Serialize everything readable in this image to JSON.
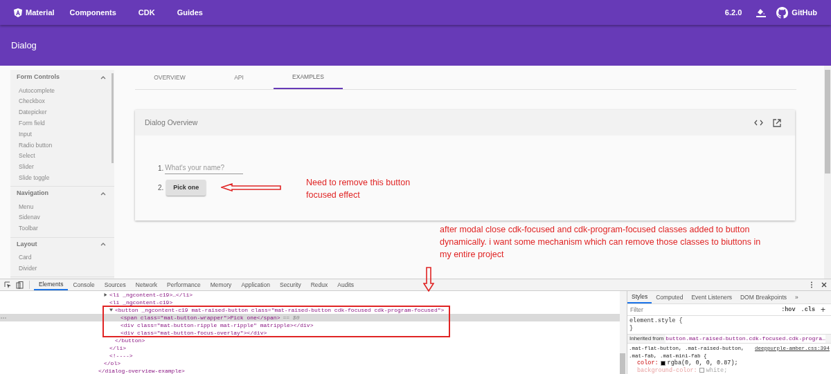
{
  "topnav": {
    "items": [
      {
        "label": "Material",
        "kind": "brand"
      },
      {
        "label": "Components",
        "kind": "link"
      },
      {
        "label": "CDK",
        "kind": "link"
      },
      {
        "label": "Guides",
        "kind": "link"
      }
    ],
    "version": "6.2.0",
    "github": "GitHub"
  },
  "header": {
    "title": "Dialog"
  },
  "sidebar": {
    "groups": [
      {
        "title": "Form Controls",
        "expanded": true,
        "items": [
          "Autocomplete",
          "Checkbox",
          "Datepicker",
          "Form field",
          "Input",
          "Radio button",
          "Select",
          "Slider",
          "Slide toggle"
        ]
      },
      {
        "title": "Navigation",
        "expanded": true,
        "items": [
          "Menu",
          "Sidenav",
          "Toolbar"
        ]
      },
      {
        "title": "Layout",
        "expanded": true,
        "items": [
          "Card",
          "Divider"
        ]
      }
    ]
  },
  "tabs": [
    {
      "label": "OVERVIEW",
      "selected": false
    },
    {
      "label": "API",
      "selected": false
    },
    {
      "label": "EXAMPLES",
      "selected": true
    }
  ],
  "example": {
    "title": "Dialog Overview",
    "steps": [
      {
        "number": "1.",
        "kind": "input",
        "placeholder": "What's your name?"
      },
      {
        "number": "2.",
        "kind": "button",
        "label": "Pick one"
      }
    ]
  },
  "annotations": [
    {
      "text": "Need to remove this button focused effect",
      "kind": "left-arrow"
    },
    {
      "text": "after modal close cdk-focused and cdk-program-focused classes added to button dynamically. i want some mechanism which can remove those classes to biuttons in my entire project",
      "kind": "down-arrow"
    }
  ],
  "devtools": {
    "tabs": [
      {
        "label": "Elements",
        "selected": true
      },
      {
        "label": "Console",
        "selected": false
      },
      {
        "label": "Sources",
        "selected": false
      },
      {
        "label": "Network",
        "selected": false
      },
      {
        "label": "Performance",
        "selected": false
      },
      {
        "label": "Memory",
        "selected": false
      },
      {
        "label": "Application",
        "selected": false
      },
      {
        "label": "Security",
        "selected": false
      },
      {
        "label": "Redux",
        "selected": false
      },
      {
        "label": "Audits",
        "selected": false
      }
    ],
    "tree": [
      {
        "close": "</dialog-overview-example>",
        "children": [
          {
            "close": "</ol>",
            "children": [
              {
                "open": "<li _ngcontent-c19>…</li>",
                "expanded": false
              },
              {
                "open": "<li _ngcontent-c19>",
                "close": "</li>",
                "children": [
                  {
                    "open": "<button _ngcontent-c19 mat-raised-button class=\"mat-raised-button cdk-focused cdk-program-focused\">",
                    "expanded": true,
                    "close": "</button>",
                    "children": [
                      {
                        "open": "<span class=\"mat-button-wrapper\">Pick one</span>",
                        "selected": true,
                        "marker": "== $0"
                      },
                      {
                        "open": "<div class=\"mat-button-ripple mat-ripple\" matripple></div>",
                        "selected": false
                      },
                      {
                        "open": "<div class=\"mat-button-focus-overlay\"></div>",
                        "selected": false
                      }
                    ]
                  }
                ]
              },
              {
                "open": "<!---->"
              }
            ]
          }
        ]
      }
    ],
    "styles": {
      "tabs": [
        {
          "label": "Styles",
          "selected": true
        },
        {
          "label": "Computed",
          "selected": false
        },
        {
          "label": "Event Listeners",
          "selected": false
        },
        {
          "label": "DOM Breakpoints",
          "selected": false
        },
        {
          "label": "»",
          "selected": false
        }
      ],
      "filter_placeholder": "Filter",
      "hov": ":hov",
      "cls": ".cls",
      "add": "+",
      "element_style": [
        "element.style {",
        "}"
      ],
      "inherited_label": "Inherited from",
      "inherited_selector": "button.mat-raised-button.cdk-focused.cdk-progra…",
      "rule": {
        "selectors": [
          ".mat-flat-button, .mat-raised-button,",
          ".mat-fab, .mat-mini-fab {"
        ],
        "source": "deeppurple-amber.css:394",
        "properties": [
          {
            "name": "color:",
            "value": "rgba(0, 0, 0, 0.87);",
            "color": "#000000",
            "overridden": false
          },
          {
            "name": "background-color:",
            "value": "white;",
            "color": "#ffffff",
            "overridden": true
          }
        ]
      }
    }
  }
}
